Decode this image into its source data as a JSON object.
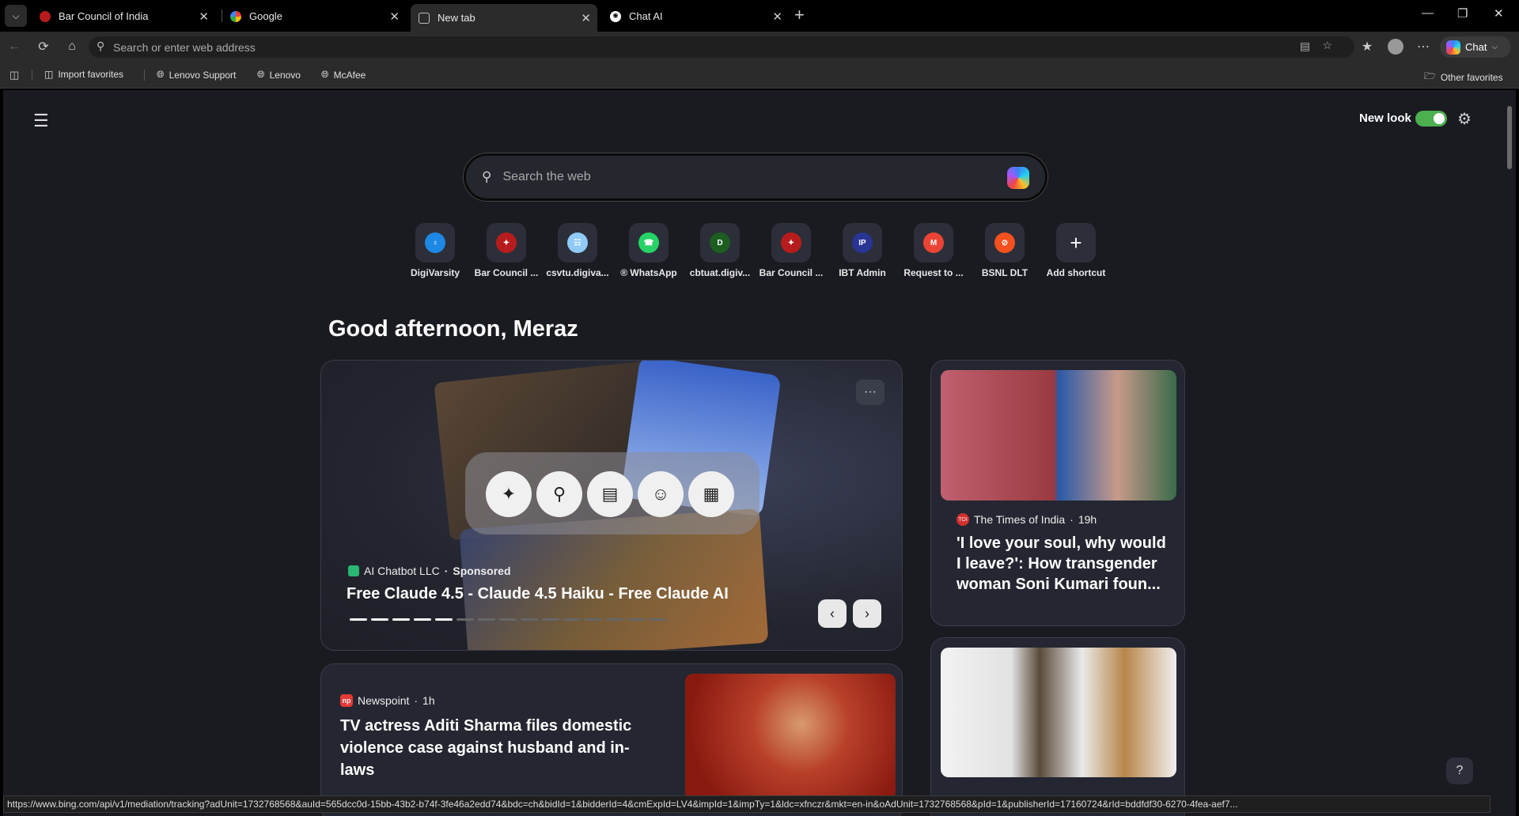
{
  "tabs": [
    {
      "title": "Bar Council of India",
      "icon": "bar-council-icon"
    },
    {
      "title": "Google",
      "icon": "google-icon"
    },
    {
      "title": "New tab",
      "icon": "newtab-icon",
      "active": true
    },
    {
      "title": "Chat AI",
      "icon": "chat-ai-icon"
    }
  ],
  "toolbar": {
    "address_placeholder": "Search or enter web address",
    "chat_label": "Chat"
  },
  "bookmarks": {
    "items": [
      "Import favorites",
      "Lenovo Support",
      "Lenovo",
      "McAfee"
    ],
    "other": "Other favorites"
  },
  "page": {
    "new_look_label": "New look",
    "new_look_enabled": true,
    "search_placeholder": "Search the web",
    "greeting": "Good afternoon, Meraz"
  },
  "shortcuts": [
    {
      "label": "DigiVarsity",
      "color": "#1e88e5",
      "glyph": "♁"
    },
    {
      "label": "Bar Council ...",
      "color": "#b71c1c",
      "glyph": "✦"
    },
    {
      "label": "csvtu.digiva...",
      "color": "#90caf9",
      "glyph": "☷"
    },
    {
      "label": "® WhatsApp",
      "color": "#25d366",
      "glyph": "☎"
    },
    {
      "label": "cbtuat.digiv...",
      "color": "#1b5e20",
      "glyph": "D"
    },
    {
      "label": "Bar Council ...",
      "color": "#b71c1c",
      "glyph": "✦"
    },
    {
      "label": "IBT Admin",
      "color": "#283593",
      "glyph": "IP"
    },
    {
      "label": "Request to ...",
      "color": "#ea4335",
      "glyph": "M"
    },
    {
      "label": "BSNL DLT",
      "color": "#f4511e",
      "glyph": "⊘"
    },
    {
      "label": "Add shortcut",
      "color": "transparent",
      "glyph": "+"
    }
  ],
  "hero": {
    "source": "AI Chatbot LLC",
    "sponsored": "Sponsored",
    "title": "Free Claude 4.5 - Claude 4.5 Haiku - Free Claude AI",
    "more_label": "···",
    "active_slides": 5,
    "total_slides": 15
  },
  "news_right_1": {
    "source": "The Times of India",
    "age": "19h",
    "title": "'I love your soul, why would I leave?': How transgender woman Soni Kumari foun..."
  },
  "news_2": {
    "source": "Newspoint",
    "age": "1h",
    "title": "TV actress Aditi Sharma files domestic violence case against husband and in-laws"
  },
  "status_url": "https://www.bing.com/api/v1/mediation/tracking?adUnit=1732768568&auId=565dcc0d-15bb-43b2-b74f-3fe46a2edd74&bdc=ch&bidId=1&bidderId=4&cmExpId=LV4&impId=1&impTy=1&ldc=xfnczr&mkt=en-in&oAdUnit=1732768568&pId=1&publisherId=17160724&rId=bddfdf30-6270-4fea-aef7..."
}
